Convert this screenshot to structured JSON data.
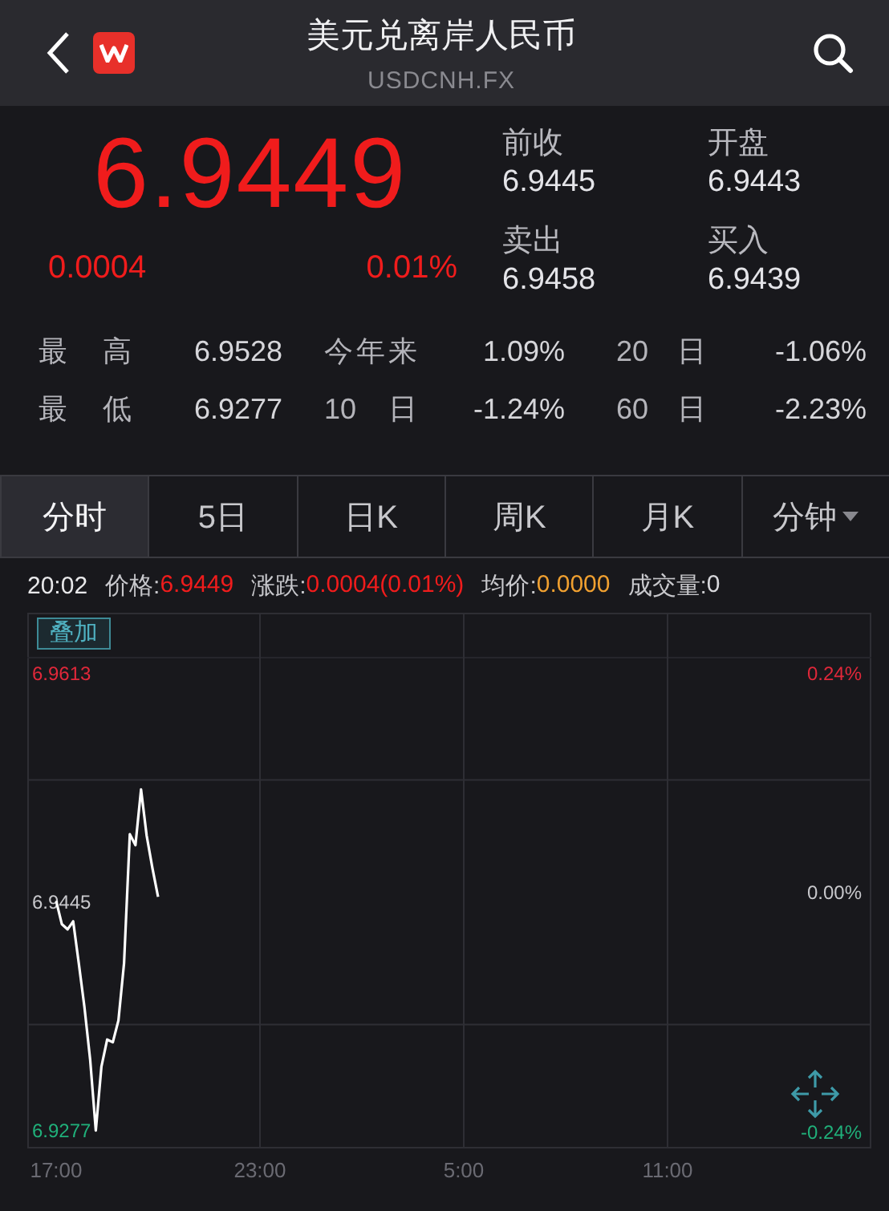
{
  "header": {
    "title": "美元兑离岸人民币",
    "subtitle": "USDCNH.FX"
  },
  "quote": {
    "price": "6.9449",
    "change": "0.0004",
    "change_percent": "0.01%",
    "fields": [
      {
        "label": "前收",
        "value": "6.9445"
      },
      {
        "label": "开盘",
        "value": "6.9443"
      },
      {
        "label": "卖出",
        "value": "6.9458"
      },
      {
        "label": "买入",
        "value": "6.9439"
      }
    ]
  },
  "stats": [
    {
      "cells": [
        {
          "label": "最 高",
          "value": "6.9528"
        },
        {
          "label": "今年来",
          "value": "1.09%"
        },
        {
          "label": "20 日",
          "value": "-1.06%"
        }
      ]
    },
    {
      "cells": [
        {
          "label": "最 低",
          "value": "6.9277"
        },
        {
          "label": "10 日",
          "value": "-1.24%"
        },
        {
          "label": "60 日",
          "value": "-2.23%"
        }
      ]
    }
  ],
  "tabs": [
    {
      "label": "分时",
      "selected": true,
      "dropdown": false
    },
    {
      "label": "5日",
      "selected": false,
      "dropdown": false
    },
    {
      "label": "日K",
      "selected": false,
      "dropdown": false
    },
    {
      "label": "周K",
      "selected": false,
      "dropdown": false
    },
    {
      "label": "月K",
      "selected": false,
      "dropdown": false
    },
    {
      "label": "分钟",
      "selected": false,
      "dropdown": true
    }
  ],
  "info_bar": {
    "time": "20:02",
    "items": [
      {
        "label": "价格:",
        "value": "6.9449",
        "color": "#f01c1c"
      },
      {
        "label": "涨跌:",
        "value": "0.0004(0.01%)",
        "color": "#f01c1c"
      },
      {
        "label": "均价:",
        "value": "0.0000",
        "color": "#f0a030"
      },
      {
        "label": "成交量:",
        "value": "0",
        "color": "#d8d8dc"
      }
    ]
  },
  "chart": {
    "overlay_button": "叠加",
    "right_labels": [
      "0.24%",
      "0.00%",
      "-0.24%"
    ],
    "chart_data": {
      "type": "line",
      "ylim": [
        6.9265,
        6.9625
      ],
      "yticks": [
        6.9613,
        6.9445,
        6.9277
      ],
      "categories": [
        "17:00",
        null,
        null,
        null,
        null,
        null,
        null,
        null,
        null,
        null,
        null,
        null,
        null,
        null,
        null,
        null,
        null,
        null,
        null,
        null,
        null,
        null,
        null,
        null,
        null,
        null,
        null,
        null,
        null,
        null,
        null,
        null,
        null,
        null,
        null,
        null,
        "23:00",
        null,
        null,
        null,
        null,
        null,
        null,
        null,
        null,
        null,
        null,
        null,
        null,
        null,
        null,
        null,
        null,
        null,
        null,
        null,
        null,
        null,
        null,
        null,
        null,
        null,
        null,
        null,
        null,
        null,
        null,
        null,
        null,
        null,
        null,
        null,
        "5:00",
        null,
        null,
        null,
        null,
        null,
        null,
        null,
        null,
        null,
        null,
        null,
        null,
        null,
        null,
        null,
        null,
        null,
        null,
        null,
        null,
        null,
        null,
        null,
        null,
        null,
        null,
        null,
        null,
        null,
        null,
        null,
        null,
        null,
        null,
        null,
        "11:00",
        null,
        null,
        null,
        null,
        null,
        null,
        null,
        null,
        null,
        null,
        null,
        null,
        null,
        null,
        null,
        null,
        null,
        null,
        null,
        null,
        null,
        null,
        null,
        null,
        null,
        null,
        null,
        null,
        null,
        null,
        null,
        null,
        null,
        null,
        null
      ],
      "series": [
        {
          "color": "#ffffff",
          "values": [
            6.9446,
            6.9429,
            6.9425,
            6.9431,
            6.94,
            6.9368,
            6.9329,
            6.9277,
            6.9324,
            6.9344,
            6.9342,
            6.9358,
            6.94,
            6.9495,
            6.9487,
            6.9528,
            6.9494,
            6.947,
            6.9449,
            null,
            null,
            null,
            null,
            null,
            null,
            null,
            null,
            null,
            null,
            null,
            null,
            null,
            null,
            null,
            null,
            null,
            null,
            null,
            null,
            null,
            null,
            null,
            null,
            null,
            null,
            null,
            null,
            null,
            null,
            null,
            null,
            null,
            null,
            null,
            null,
            null,
            null,
            null,
            null,
            null,
            null,
            null,
            null,
            null,
            null,
            null,
            null,
            null,
            null,
            null,
            null,
            null,
            null,
            null,
            null,
            null,
            null,
            null,
            null,
            null,
            null,
            null,
            null,
            null,
            null,
            null,
            null,
            null,
            null,
            null,
            null,
            null,
            null,
            null,
            null,
            null,
            null,
            null,
            null,
            null,
            null,
            null,
            null,
            null,
            null,
            null,
            null,
            null,
            null,
            null,
            null,
            null,
            null,
            null,
            null,
            null,
            null,
            null,
            null,
            null,
            null,
            null,
            null,
            null,
            null,
            null,
            null,
            null,
            null,
            null,
            null,
            null,
            null,
            null,
            null,
            null,
            null,
            null,
            null,
            null,
            null,
            null,
            null,
            null
          ]
        }
      ]
    }
  }
}
